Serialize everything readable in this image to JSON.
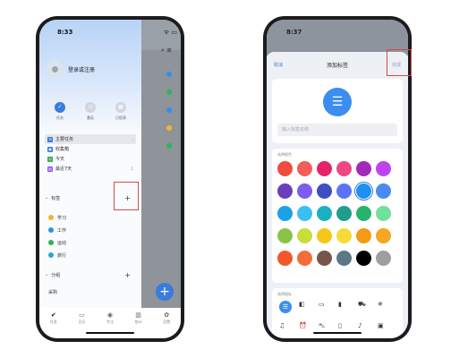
{
  "left_phone": {
    "status_time": "8:33",
    "status_icons": "ᯤ ▭",
    "bg_toolbar_icons": "⌕  ≡",
    "profile": {
      "label": "登录或注册"
    },
    "quick_actions": [
      {
        "label": "任务",
        "icon": "✓"
      },
      {
        "label": "番茄",
        "icon": "◷"
      },
      {
        "label": "日程表",
        "icon": "▦"
      }
    ],
    "nav_items": [
      {
        "label": "主要任务",
        "icon": "☰",
        "color": "#3b7bdc",
        "count": "›"
      },
      {
        "label": "收集箱",
        "icon": "▣",
        "color": "#3b7bdc",
        "count": ""
      },
      {
        "label": "今天",
        "icon": "◎",
        "color": "#3aa757",
        "count": ""
      },
      {
        "label": "最近7天",
        "icon": "▤",
        "color": "#8b5cf6",
        "count": "1"
      }
    ],
    "tags_section": {
      "label": "标签",
      "add": "+"
    },
    "tags": [
      {
        "label": "学习",
        "color": "#f2b632"
      },
      {
        "label": "工作",
        "color": "#2f8fe8"
      },
      {
        "label": "运动",
        "color": "#2fb457"
      },
      {
        "label": "旅行",
        "color": "#2aa7c9"
      }
    ],
    "list_section": {
      "label": "分组",
      "add": "+"
    },
    "list_item": "采购",
    "tabs": [
      {
        "label": "任务",
        "icon": "✔"
      },
      {
        "label": "日历",
        "icon": "▭"
      },
      {
        "label": "专注",
        "icon": "◉"
      },
      {
        "label": "统计",
        "icon": "▥"
      },
      {
        "label": "设置",
        "icon": "✿"
      }
    ],
    "bg_fab": "+"
  },
  "right_phone": {
    "status_time": "8:37",
    "header": {
      "cancel": "取消",
      "title": "添加标签",
      "done": "完成"
    },
    "input": {
      "placeholder": "输入标签名称",
      "value": ""
    },
    "color_section": {
      "label": "选择颜色"
    },
    "colors": [
      "#ef4c3f",
      "#f45b5b",
      "#e6236a",
      "#ef4685",
      "#a32ab8",
      "#c042ef",
      "#6b3fba",
      "#7d5cf0",
      "#3f4ec0",
      "#5b73f7",
      "#1f8ff0",
      "#4a8af4",
      "#1aa2e8",
      "#38c0f2",
      "#1bb0bf",
      "#1f9f8a",
      "#27b36b",
      "#6ee19a",
      "#8bc34a",
      "#c7dd3b",
      "#f6c619",
      "#f7da3a",
      "#f49a14",
      "#f5a623",
      "#f2572b",
      "#f36d3a",
      "#76554a",
      "#5d7884",
      "#000000",
      "#9e9e9e"
    ],
    "selected_color": "#1f8ff0",
    "icon_section": {
      "label": "选择图标"
    },
    "icons_row1": [
      {
        "name": "list-icon",
        "glyph": "☰"
      },
      {
        "name": "toggle-icon",
        "glyph": "◧"
      },
      {
        "name": "laptop-icon",
        "glyph": "▭"
      },
      {
        "name": "book-icon",
        "glyph": "▮"
      },
      {
        "name": "cart-icon",
        "glyph": "⛟"
      },
      {
        "name": "run-icon",
        "glyph": "✵"
      }
    ],
    "icons_row2": [
      {
        "name": "headphones-icon",
        "glyph": "♫"
      },
      {
        "name": "alarm-icon",
        "glyph": "⏰"
      },
      {
        "name": "car-icon",
        "glyph": "⛍"
      },
      {
        "name": "phone-icon",
        "glyph": "▯"
      },
      {
        "name": "bell-icon",
        "glyph": "♪"
      },
      {
        "name": "bus-icon",
        "glyph": "▣"
      }
    ]
  },
  "annotation_color": "#d8474b"
}
